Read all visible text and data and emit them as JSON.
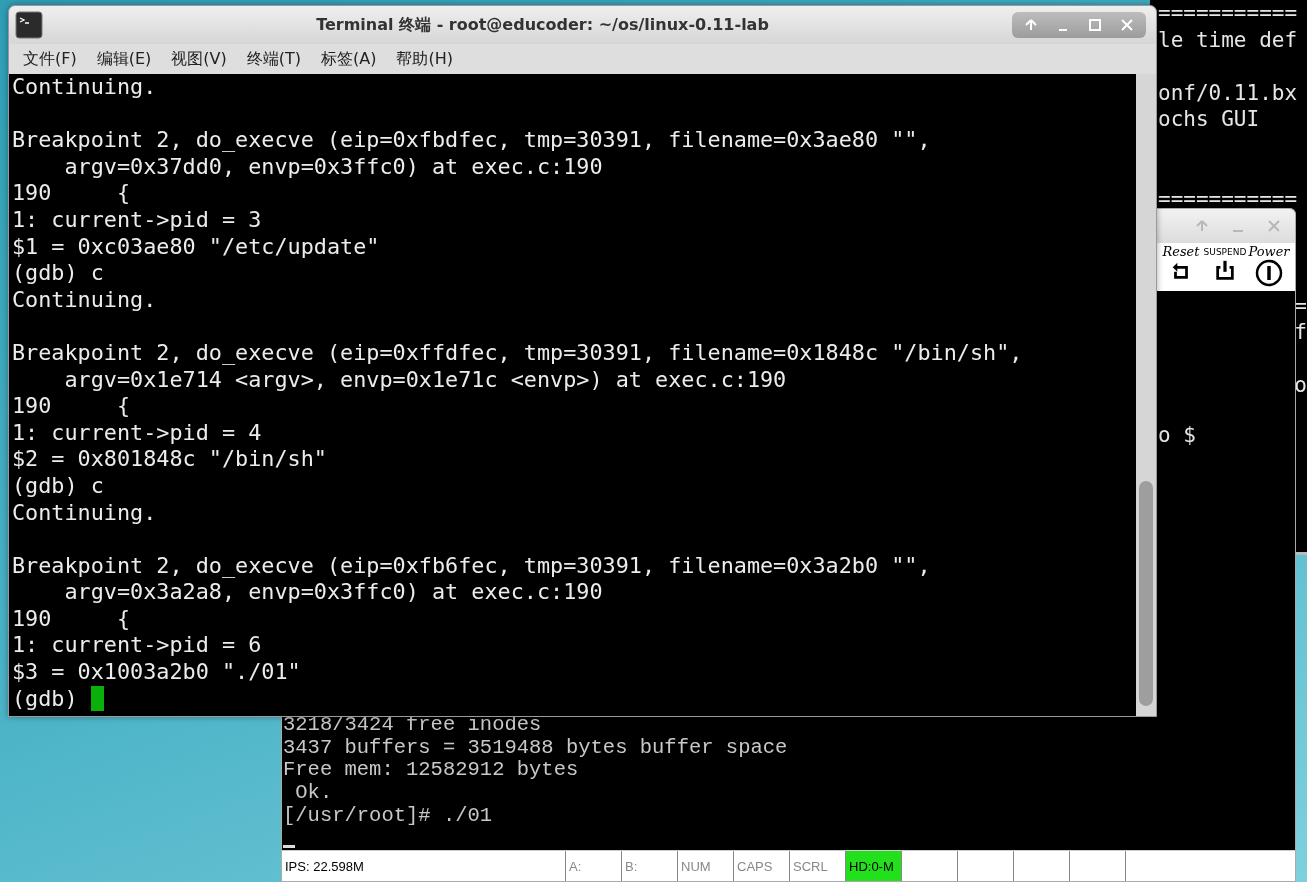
{
  "main_terminal": {
    "title": "Terminal 终端 - root@educoder: ~/os/linux-0.11-lab",
    "menu": [
      "文件(F)",
      "编辑(E)",
      "视图(V)",
      "终端(T)",
      "标签(A)",
      "帮助(H)"
    ],
    "blocks": [
      [
        "Continuing."
      ],
      [
        "Breakpoint 2, do_execve (eip=0xfbdfec, tmp=30391, filename=0x3ae80 \"\",",
        "    argv=0x37dd0, envp=0x3ffc0) at exec.c:190",
        "190     {",
        "1: current->pid = 3",
        "$1 = 0xc03ae80 \"/etc/update\"",
        "(gdb) c",
        "Continuing."
      ],
      [
        "Breakpoint 2, do_execve (eip=0xffdfec, tmp=30391, filename=0x1848c \"/bin/sh\",",
        "    argv=0x1e714 <argv>, envp=0x1e71c <envp>) at exec.c:190",
        "190     {",
        "1: current->pid = 4",
        "$2 = 0x801848c \"/bin/sh\"",
        "(gdb) c",
        "Continuing."
      ],
      [
        "Breakpoint 2, do_execve (eip=0xfb6fec, tmp=30391, filename=0x3a2b0 \"\",",
        "    argv=0x3a2a8, envp=0x3ffc0) at exec.c:190",
        "190     {",
        "1: current->pid = 6",
        "$3 = 0x1003a2b0 \"./01\""
      ]
    ],
    "prompt": "(gdb)"
  },
  "background_terminal": {
    "lines": [
      {
        "kind": "left",
        "text": "==========="
      },
      {
        "kind": "left",
        "text": "le time def"
      },
      {
        "kind": "blank"
      },
      {
        "kind": "left",
        "text": "onf/0.11.bx"
      },
      {
        "kind": "left",
        "text": "ochs GUI"
      },
      {
        "kind": "blank"
      },
      {
        "kind": "blank"
      },
      {
        "kind": "left",
        "text": "==========="
      },
      {
        "kind": "blank"
      },
      {
        "kind": "blank"
      },
      {
        "kind": "blank"
      },
      {
        "kind": "right",
        "text": "="
      },
      {
        "kind": "right",
        "text": "f"
      },
      {
        "kind": "blank"
      },
      {
        "kind": "right",
        "text": "o"
      }
    ],
    "show_through": "o $"
  },
  "bochs": {
    "toolbar": [
      {
        "label": "Reset",
        "kind": "reset"
      },
      {
        "label": "SUSPEND",
        "kind": "suspend"
      },
      {
        "label": "Power",
        "kind": "power"
      }
    ],
    "console": [
      "3218/3424 free inodes",
      "3437 buffers = 3519488 bytes buffer space",
      "Free mem: 12582912 bytes",
      " Ok.",
      "[/usr/root]# ./01"
    ],
    "status_bar": {
      "ips": "IPS: 22.598M",
      "indicators": [
        {
          "label": "A:",
          "on": false
        },
        {
          "label": "B:",
          "on": false
        },
        {
          "label": "NUM",
          "on": false
        },
        {
          "label": "CAPS",
          "on": false
        },
        {
          "label": "SCRL",
          "on": false
        },
        {
          "label": "HD:0-M",
          "on": true
        }
      ]
    }
  }
}
